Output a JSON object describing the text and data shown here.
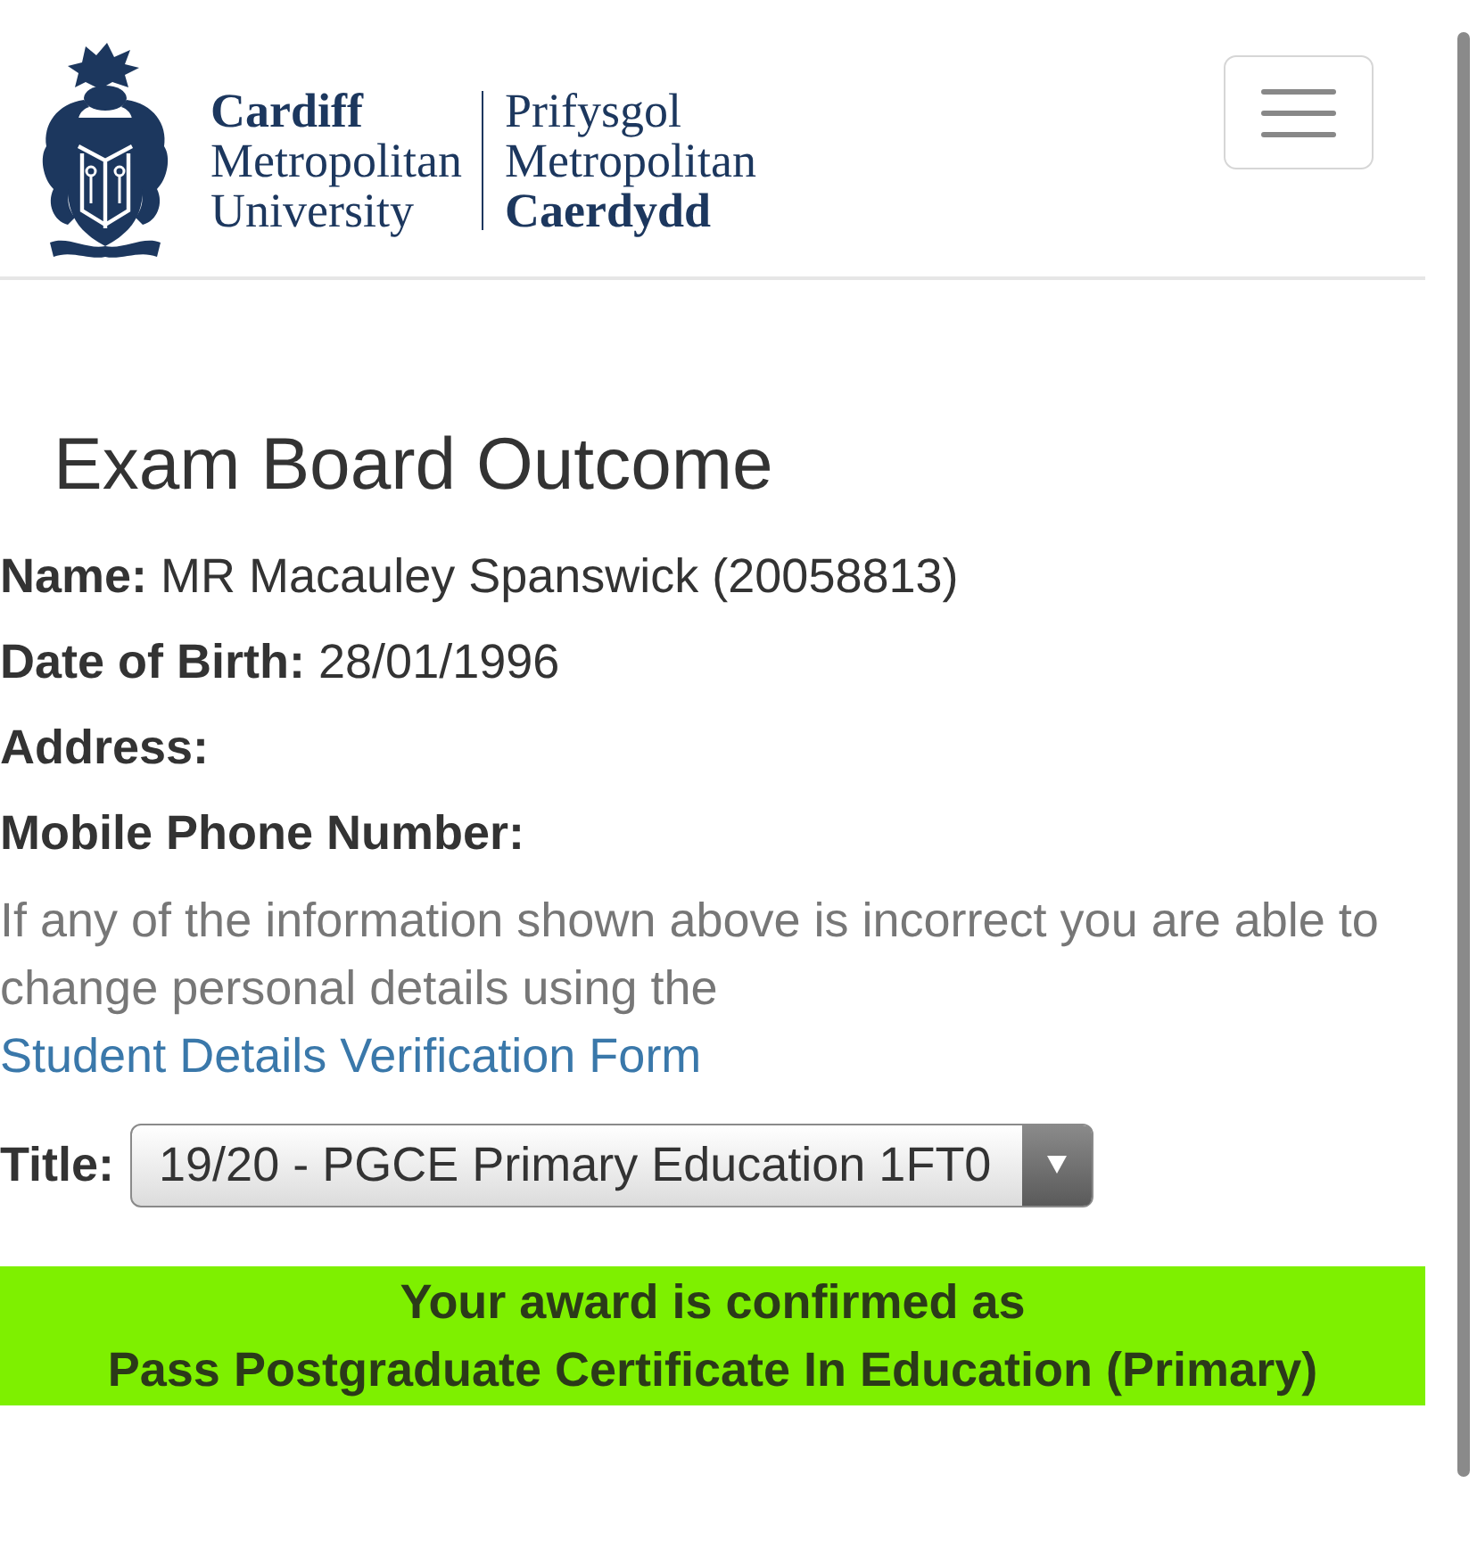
{
  "header": {
    "logo": {
      "english": [
        "Cardiff",
        "Metropolitan",
        "University"
      ],
      "welsh": [
        "Prifysgol",
        "Metropolitan",
        "Caerdydd"
      ]
    }
  },
  "heading": "Exam Board Outcome",
  "details": [
    {
      "label": "Name:",
      "value": "MR Macauley Spanswick (20058813)"
    },
    {
      "label": "Date of Birth:",
      "value": "28/01/1996"
    },
    {
      "label": "Address:"
    },
    {
      "label": "Mobile Phone Number:"
    }
  ],
  "notice": {
    "text": "If any of the information shown above is incorrect you are able to change personal details using the",
    "link": "Student Details Verification Form"
  },
  "title_select": {
    "label": "Title:",
    "value": "19/20 - PGCE Primary Education 1FT0"
  },
  "award": {
    "lines": [
      "Your award is confirmed as",
      "Pass Postgraduate Certificate In Education (Primary)"
    ]
  }
}
